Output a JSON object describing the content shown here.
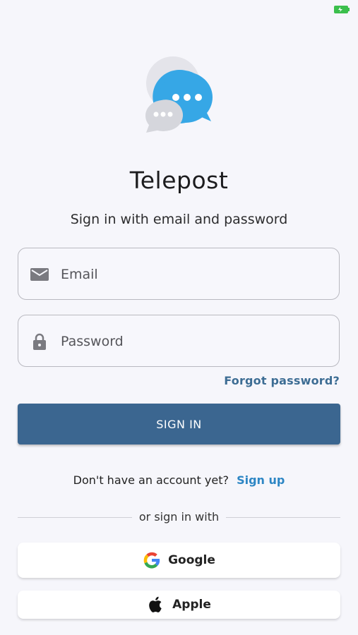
{
  "app": {
    "title": "Telepost",
    "subtitle": "Sign in with email and password"
  },
  "form": {
    "email_placeholder": "Email",
    "password_placeholder": "Password",
    "forgot_password": "Forgot password?",
    "signin_label": "SIGN IN"
  },
  "signup": {
    "prompt": "Don't have an account yet?",
    "link": "Sign up"
  },
  "divider": {
    "text": "or sign in with"
  },
  "social": {
    "google_label": "Google",
    "apple_label": "Apple"
  },
  "colors": {
    "primary": "#3b6690",
    "link": "#2d86c4",
    "background": "#f6f6fb"
  },
  "icons": [
    "battery-icon",
    "chat-bubbles-logo-icon",
    "mail-icon",
    "lock-icon",
    "google-icon",
    "apple-icon"
  ]
}
